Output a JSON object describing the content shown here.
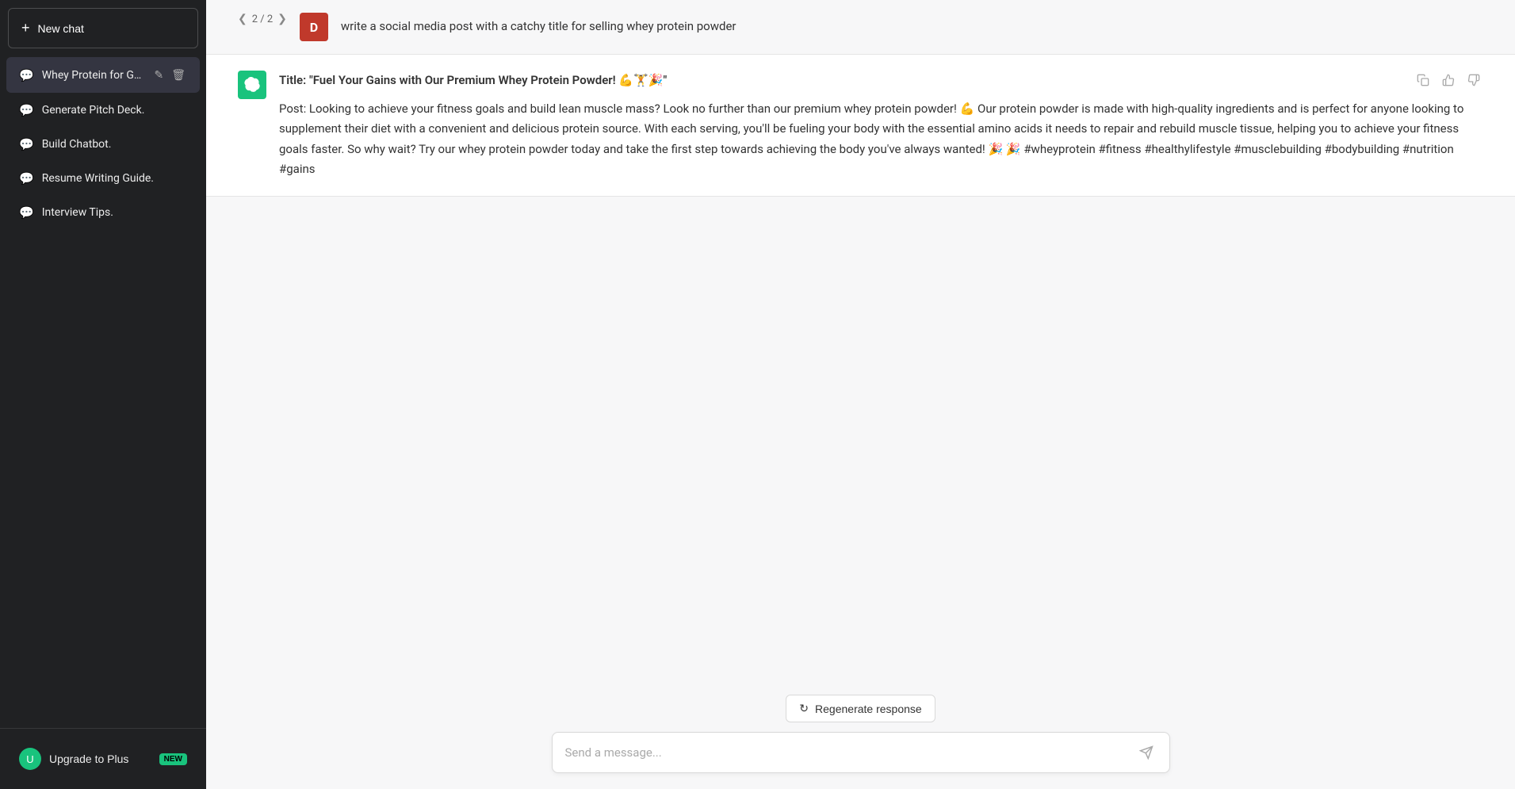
{
  "sidebar": {
    "new_chat_label": "New chat",
    "chats": [
      {
        "id": "whey-protein",
        "label": "Whey Protein for Gains.",
        "active": true,
        "show_actions": true
      },
      {
        "id": "pitch-deck",
        "label": "Generate Pitch Deck.",
        "active": false,
        "show_actions": false
      },
      {
        "id": "build-chatbot",
        "label": "Build Chatbot.",
        "active": false,
        "show_actions": false
      },
      {
        "id": "resume-writing",
        "label": "Resume Writing Guide.",
        "active": false,
        "show_actions": false
      },
      {
        "id": "interview-tips",
        "label": "Interview Tips.",
        "active": false,
        "show_actions": false
      }
    ],
    "bottom": {
      "upgrade_label": "Upgrade to Plus",
      "new_badge": "NEW",
      "user_initial": "U"
    }
  },
  "chat": {
    "pagination": {
      "current": 2,
      "total": 2
    },
    "user": {
      "initial": "D",
      "message": "write a social media post with a catchy title for selling whey protein powder"
    },
    "assistant": {
      "title": "Title: \"Fuel Your Gains with Our Premium Whey Protein Powder! 💪🏋️🎉\"",
      "body": "Post: Looking to achieve your fitness goals and build lean muscle mass? Look no further than our premium whey protein powder! 💪 Our protein powder is made with high-quality ingredients and is perfect for anyone looking to supplement their diet with a convenient and delicious protein source. With each serving, you'll be fueling your body with the essential amino acids it needs to repair and rebuild muscle tissue, helping you to achieve your fitness goals faster. So why wait? Try our whey protein powder today and take the first step towards achieving the body you've always wanted! 🎉 🎉 #wheyprotein #fitness #healthylifestyle #musclebuilding #bodybuilding #nutrition #gains"
    },
    "regenerate_label": "Regenerate response",
    "input_placeholder": "Send a message..."
  }
}
